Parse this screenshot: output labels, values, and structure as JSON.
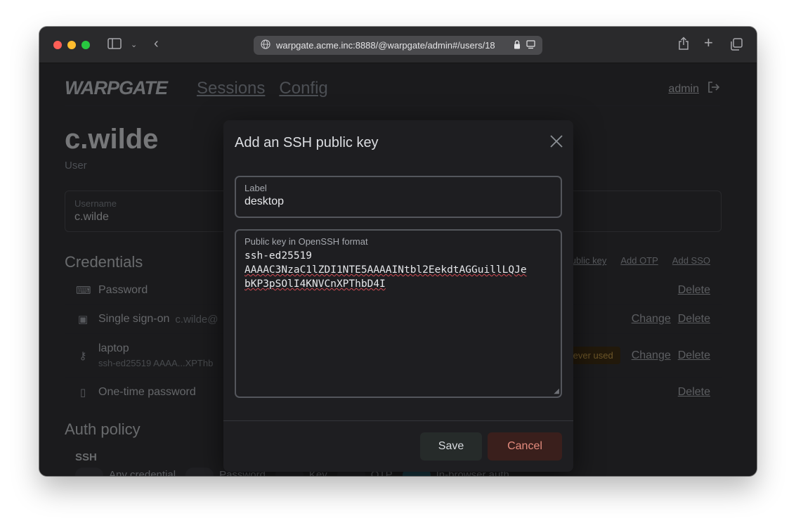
{
  "browser": {
    "url": "warpgate.acme.inc:8888/@warpgate/admin#/users/18"
  },
  "app": {
    "logo": "WARPGATE",
    "nav": [
      "Sessions",
      "Config"
    ],
    "user_link": "admin",
    "user": {
      "name": "c.wilde",
      "role": "User",
      "username_label": "Username",
      "username_value": "c.wilde"
    },
    "credentials": {
      "title": "Credentials",
      "actions": [
        "Add public key",
        "Add OTP",
        "Add SSO"
      ],
      "rows": [
        {
          "icon": "keyboard-icon",
          "label": "Password",
          "sub": "",
          "badge": "",
          "actions": [
            "Delete"
          ]
        },
        {
          "icon": "id-card-icon",
          "label": "Single sign-on",
          "sub": "c.wilde@",
          "badge": "",
          "actions": [
            "Change",
            "Delete"
          ]
        },
        {
          "icon": "key-icon",
          "label": "laptop",
          "sub": "ssh-ed25519 AAAA...XPThb",
          "badge": "Never used",
          "actions": [
            "Change",
            "Delete"
          ]
        },
        {
          "icon": "phone-icon",
          "label": "One-time password",
          "sub": "",
          "badge": "",
          "actions": [
            "Delete"
          ]
        }
      ]
    },
    "auth_policy": {
      "title": "Auth policy",
      "ssh_label": "SSH",
      "options": [
        {
          "label": "Any credential",
          "on": false
        },
        {
          "label": "Password",
          "on": false
        },
        {
          "label": "Key",
          "on": false
        },
        {
          "label": "OTP",
          "on": false
        },
        {
          "label": "In-browser auth",
          "on": true
        }
      ]
    }
  },
  "modal": {
    "title": "Add an SSH public key",
    "label_field": {
      "label": "Label",
      "value": "desktop"
    },
    "key_field": {
      "label": "Public key in OpenSSH format",
      "value_line1": "ssh-ed25519",
      "value_line2": "AAAAC3NzaC1lZDI1NTE5AAAAINtbl2EekdtAGGuillLQJe",
      "value_line3": "bKP3pSOlI4KNVCnXPThbD4I"
    },
    "save_label": "Save",
    "cancel_label": "Cancel"
  }
}
